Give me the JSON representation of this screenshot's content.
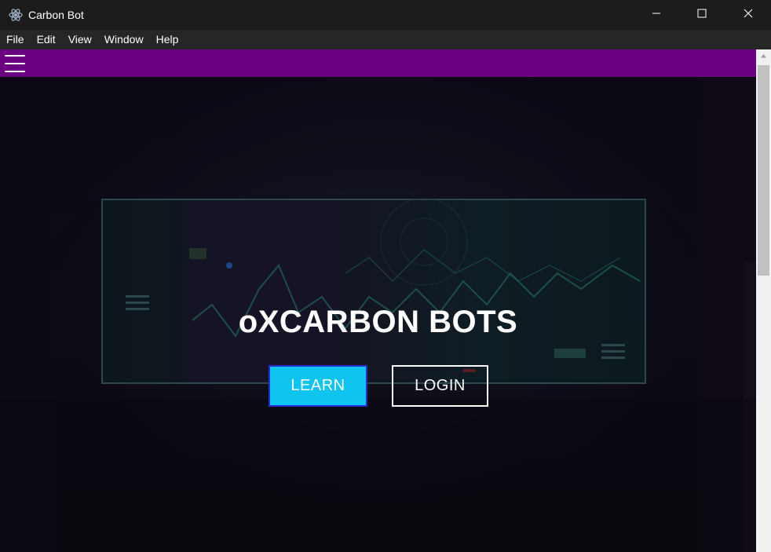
{
  "window": {
    "title": "Carbon Bot",
    "icons": {
      "app": "electron-atom-icon",
      "minimize": "minimize-icon",
      "maximize": "maximize-icon",
      "close": "close-icon"
    }
  },
  "menu": {
    "items": [
      {
        "label": "File"
      },
      {
        "label": "Edit"
      },
      {
        "label": "View"
      },
      {
        "label": "Window"
      },
      {
        "label": "Help"
      }
    ]
  },
  "navbar": {
    "menu_icon": "hamburger-menu-icon",
    "background": "#6a0082"
  },
  "hero": {
    "title": "oXCARBON BOTS",
    "learn_label": "LEARN",
    "login_label": "LOGIN",
    "learn_color": "#0fc4ef"
  }
}
